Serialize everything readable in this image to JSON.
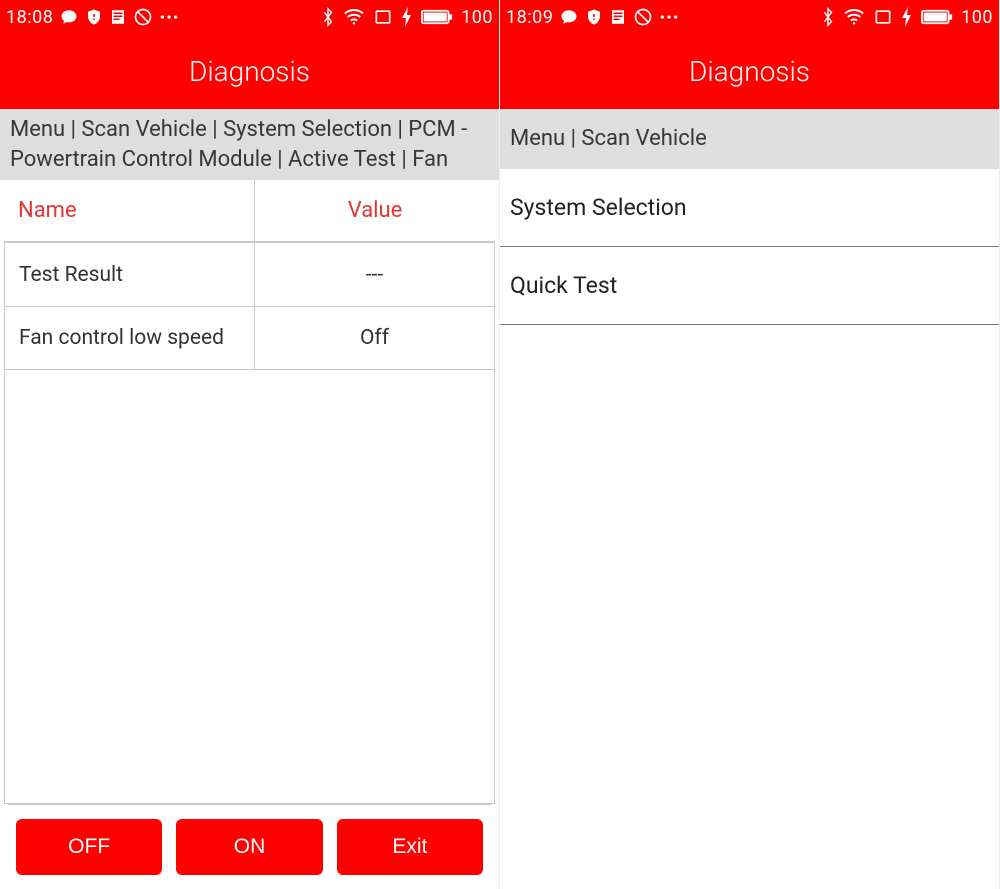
{
  "left": {
    "status": {
      "time": "18:08",
      "battery": "100"
    },
    "title": "Diagnosis",
    "breadcrumb": "Menu | Scan Vehicle | System Selection | PCM - Powertrain Control Module | Active Test | Fan",
    "table": {
      "headers": {
        "name": "Name",
        "value": "Value"
      },
      "rows": [
        {
          "name": "Test Result",
          "value": "---"
        },
        {
          "name": "Fan control low speed",
          "value": "Off"
        }
      ]
    },
    "buttons": {
      "off": "OFF",
      "on": "ON",
      "exit": "Exit"
    }
  },
  "right": {
    "status": {
      "time": "18:09",
      "battery": "100"
    },
    "title": "Diagnosis",
    "breadcrumb": "Menu | Scan Vehicle",
    "menu": [
      {
        "label": "System Selection"
      },
      {
        "label": "Quick Test"
      }
    ]
  }
}
